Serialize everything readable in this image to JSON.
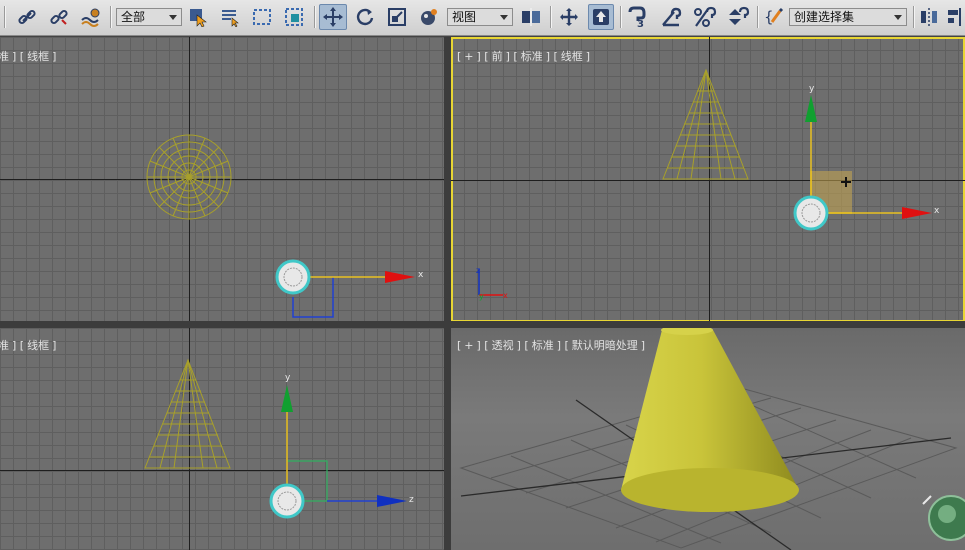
{
  "toolbar": {
    "selection_filter": "全部",
    "reference_coord": "视图",
    "named_selection": "创建选择集",
    "icons": [
      "link-icon",
      "unlink-icon",
      "bind-spacewarp-icon",
      "select-object-icon",
      "select-by-name-icon",
      "rect-region-icon",
      "window-crossing-icon",
      "move-icon",
      "rotate-icon",
      "scale-icon",
      "material-icon",
      "pivot-icon",
      "manipulate-icon",
      "snap-3d-icon",
      "angle-snap-icon",
      "percent-snap-icon",
      "spinner-snap-icon",
      "edit-named-sets-icon",
      "mirror-icon"
    ]
  },
  "viewports": {
    "top_left": {
      "labels": [
        "准",
        "线框"
      ]
    },
    "front": {
      "labels": [
        "+",
        "前",
        "标准",
        "线框"
      ]
    },
    "bottom_left": {
      "labels": [
        "准",
        "线框"
      ]
    },
    "perspective": {
      "labels": [
        "+",
        "透视",
        "标准",
        "默认明暗处理"
      ]
    }
  },
  "gizmo": {
    "x": "x",
    "y": "y",
    "z": "z"
  },
  "colors": {
    "active_border": "#e8d634",
    "wire": "#a8a02a",
    "cone": "#c8c43a",
    "x_axis": "#e01010",
    "y_axis": "#109030",
    "z_axis": "#1030c0"
  }
}
